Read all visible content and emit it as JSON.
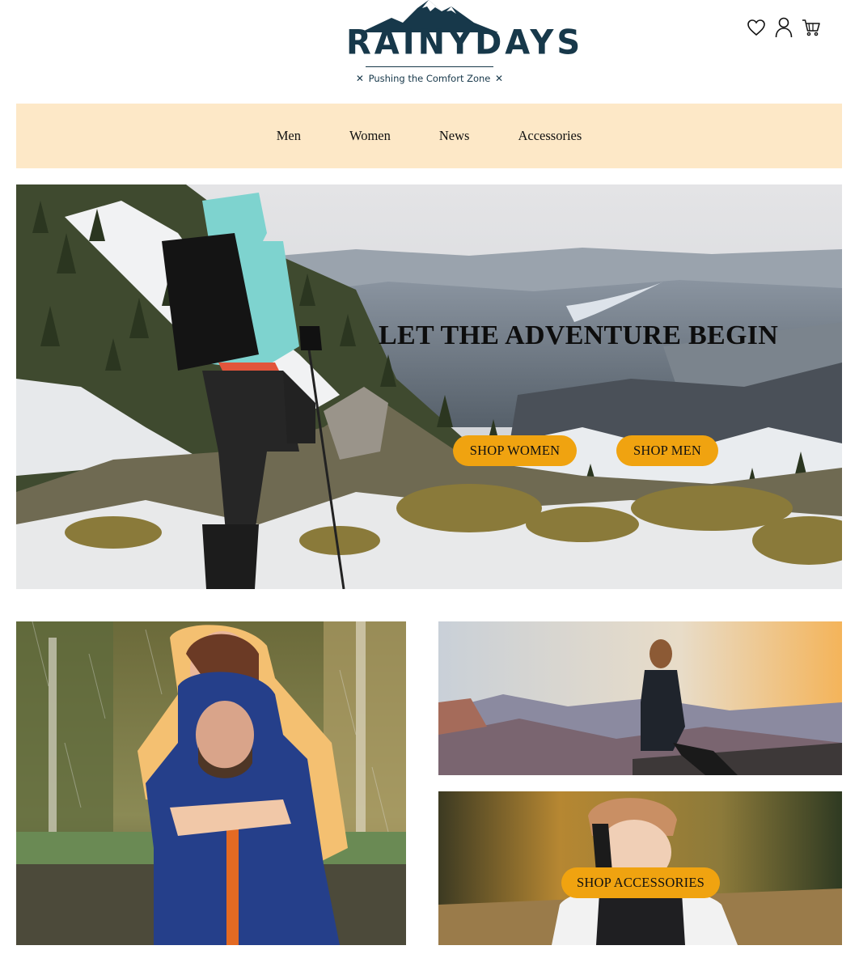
{
  "brand": {
    "name": "RAINYDAYS",
    "tagline": "Pushing the Comfort Zone",
    "color": "#17384a"
  },
  "header": {
    "icons": [
      "heart-icon",
      "user-icon",
      "cart-icon"
    ]
  },
  "nav": {
    "background": "#fde8c7",
    "items": [
      {
        "label": "Men"
      },
      {
        "label": "Women"
      },
      {
        "label": "News"
      },
      {
        "label": "Accessories"
      }
    ]
  },
  "hero": {
    "title": "LET THE ADVENTURE BEGIN",
    "shop_women_label": "SHOP WOMEN",
    "shop_men_label": "SHOP MEN"
  },
  "accessories": {
    "button_label": "SHOP ACCESSORIES"
  },
  "colors": {
    "accent": "#f0a310"
  }
}
